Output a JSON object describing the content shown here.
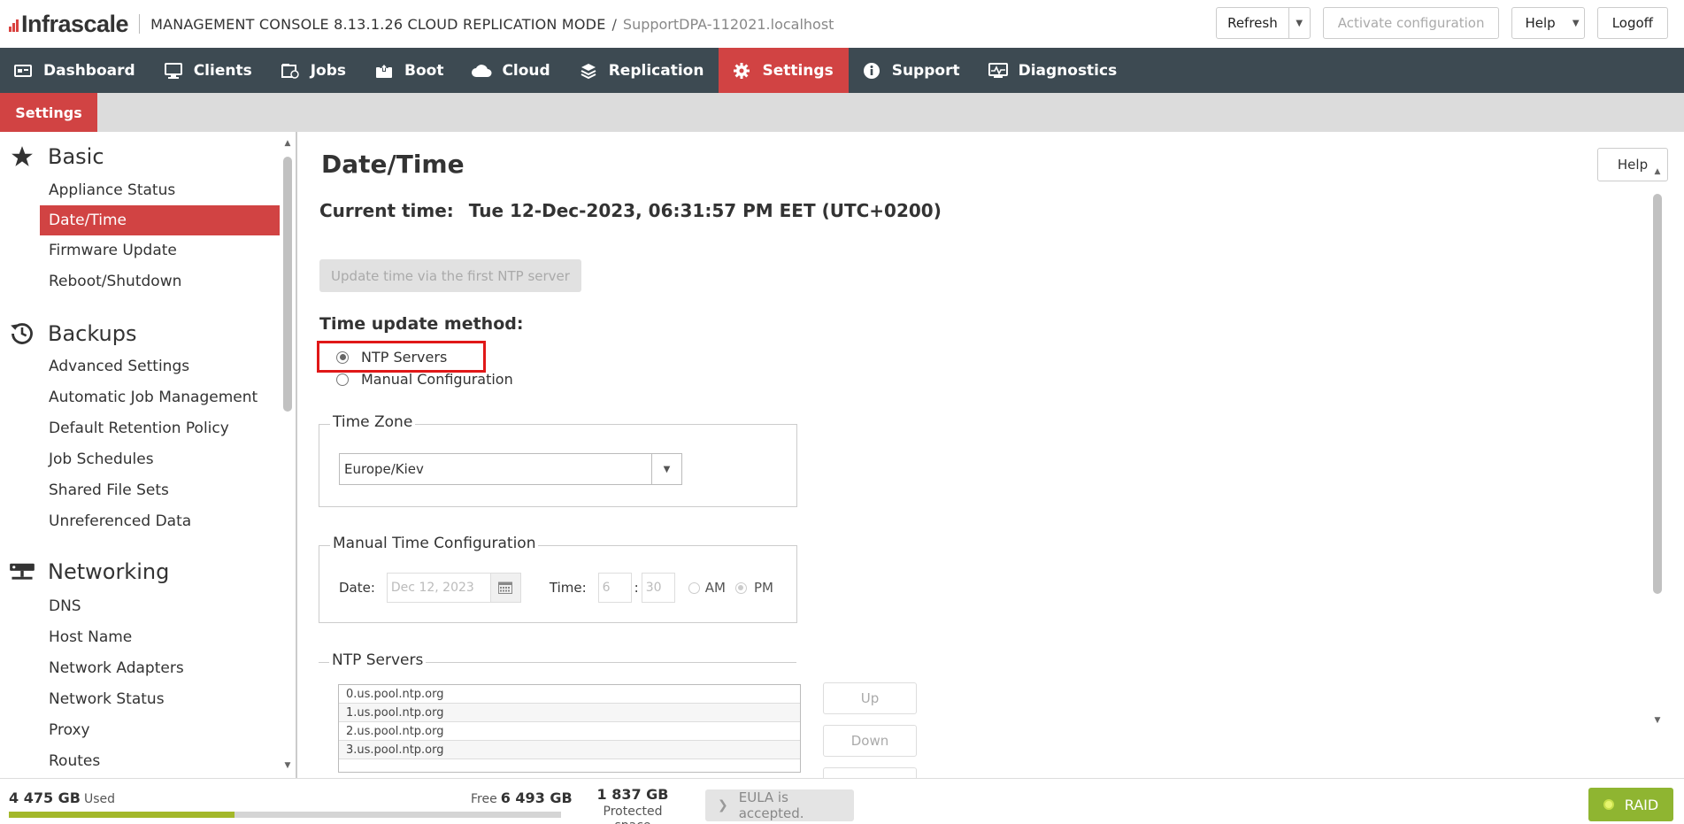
{
  "header": {
    "logo_text": "Infrascale",
    "console_title": "MANAGEMENT CONSOLE 8.13.1.26 CLOUD REPLICATION MODE",
    "separator": "/",
    "hostname": "SupportDPA-112021.localhost",
    "refresh_label": "Refresh",
    "activate_label": "Activate configuration",
    "help_label": "Help",
    "logoff_label": "Logoff"
  },
  "nav": {
    "items": [
      {
        "label": "Dashboard",
        "icon": "dashboard-icon"
      },
      {
        "label": "Clients",
        "icon": "monitor-icon"
      },
      {
        "label": "Jobs",
        "icon": "jobs-icon"
      },
      {
        "label": "Boot",
        "icon": "boot-icon"
      },
      {
        "label": "Cloud",
        "icon": "cloud-icon"
      },
      {
        "label": "Replication",
        "icon": "replication-icon"
      },
      {
        "label": "Settings",
        "icon": "gear-icon"
      },
      {
        "label": "Support",
        "icon": "info-icon"
      },
      {
        "label": "Diagnostics",
        "icon": "diagnostics-icon"
      }
    ],
    "active": "Settings"
  },
  "subnav": {
    "tab": "Settings"
  },
  "sidebar": {
    "basic": {
      "title": "Basic",
      "items": [
        "Appliance Status",
        "Date/Time",
        "Firmware Update",
        "Reboot/Shutdown"
      ]
    },
    "backups": {
      "title": "Backups",
      "items": [
        "Advanced Settings",
        "Automatic Job Management",
        "Default Retention Policy",
        "Job Schedules",
        "Shared File Sets",
        "Unreferenced Data"
      ]
    },
    "networking": {
      "title": "Networking",
      "items": [
        "DNS",
        "Host Name",
        "Network Adapters",
        "Network Status",
        "Proxy",
        "Routes"
      ]
    },
    "active_item": "Date/Time"
  },
  "content": {
    "title": "Date/Time",
    "help_label": "Help",
    "current_time_label": "Current time:",
    "current_time_value": "Tue 12-Dec-2023, 06:31:57 PM EET (UTC+0200)",
    "update_button": "Update time via the first NTP server",
    "method_heading": "Time update method:",
    "method_options": [
      "NTP Servers",
      "Manual Configuration"
    ],
    "method_selected": "NTP Servers",
    "timezone": {
      "legend": "Time Zone",
      "value": "Europe/Kiev"
    },
    "manual": {
      "legend": "Manual Time Configuration",
      "date_label": "Date:",
      "date_value": "Dec 12, 2023",
      "time_label": "Time:",
      "hour": "6",
      "minute": "30",
      "colon": ":",
      "am": "AM",
      "pm": "PM",
      "ampm_selected": "PM"
    },
    "ntp": {
      "legend": "NTP Servers",
      "servers": [
        "0.us.pool.ntp.org",
        "1.us.pool.ntp.org",
        "2.us.pool.ntp.org",
        "3.us.pool.ntp.org"
      ],
      "up_label": "Up",
      "down_label": "Down"
    }
  },
  "footer": {
    "used_value": "4 475 GB",
    "used_label": "Used",
    "free_label": "Free",
    "free_value": "6 493 GB",
    "used_fraction": 0.408,
    "protected_value": "1 837 GB",
    "protected_label": "Protected space",
    "eula": "EULA is accepted.",
    "raid": "RAID"
  },
  "colors": {
    "accent": "#d14343",
    "nav_bg": "#3d4a52",
    "raid_green": "#8fb531",
    "bar_fill": "#a3b82a"
  }
}
